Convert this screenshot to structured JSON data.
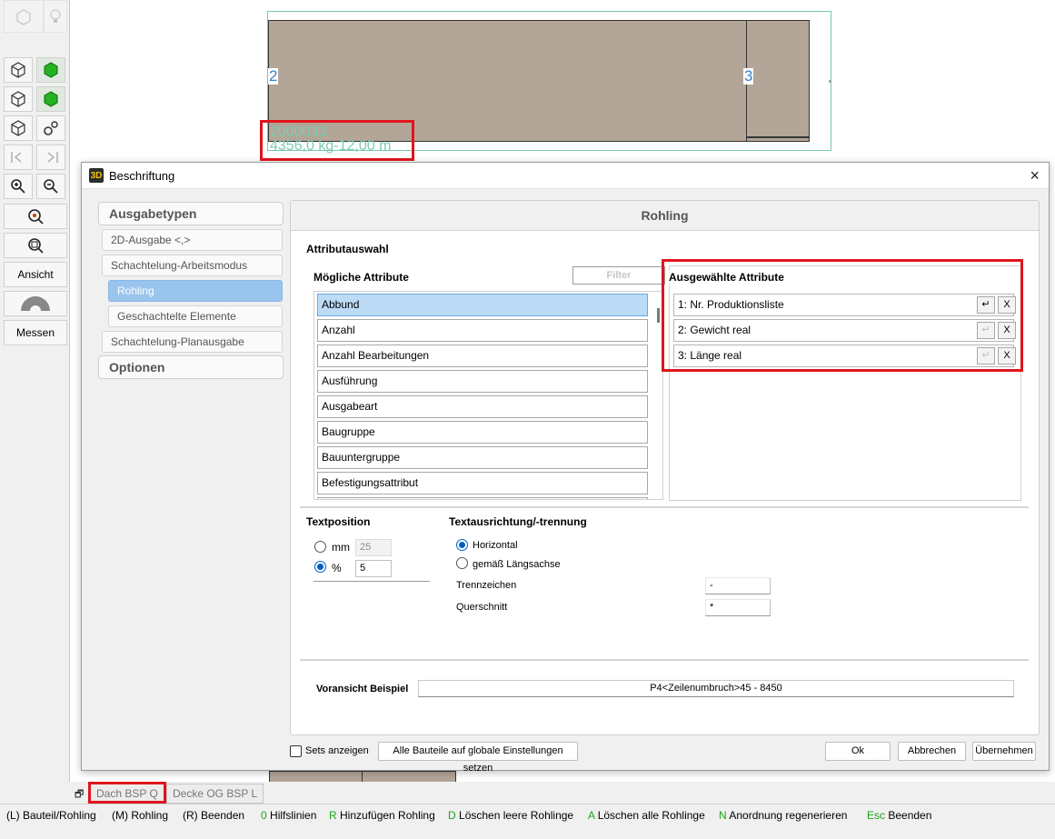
{
  "toolbar": {
    "ansicht": "Ansicht",
    "messen": "Messen"
  },
  "canvas": {
    "num_left": "2",
    "num_right": "3",
    "label_line1": "2000033",
    "label_line2": "4356,0 kg-12,00 m"
  },
  "dialog": {
    "title": "Beschriftung",
    "close": "×",
    "app_icon": "3D",
    "nav": {
      "ausgabetypen": "Ausgabetypen",
      "items": [
        "2D-Ausgabe <,>",
        "Schachtelung-Arbeitsmodus",
        "Rohling",
        "Geschachtelte Elemente",
        "Schachtelung-Planausgabe"
      ],
      "optionen": "Optionen"
    },
    "panel": {
      "title": "Rohling",
      "attributauswahl": "Attributauswahl",
      "moegliche": "Mögliche Attribute",
      "filter_placeholder": "Filter",
      "ausgewaehlte": "Ausgewählte Attribute",
      "possible_attributes": [
        "Abbund",
        "Anzahl",
        "Anzahl Bearbeitungen",
        "Ausführung",
        "Ausgabeart",
        "Baugruppe",
        "Bauuntergruppe",
        "Befestigungsattribut"
      ],
      "selected_attributes": [
        {
          "label": "1: Nr. Produktionsliste",
          "enter": "↵",
          "remove": "X"
        },
        {
          "label": "2: Gewicht real",
          "enter": "↵",
          "remove": "X"
        },
        {
          "label": "3: Länge real",
          "enter": "↵",
          "remove": "X"
        }
      ],
      "textposition": "Textposition",
      "mm_label": "mm",
      "mm_value": "25",
      "pct_label": "%",
      "pct_value": "5",
      "textausrichtung": "Textausrichtung/-trennung",
      "horizontal": "Horizontal",
      "laengsachse": "gemäß Längsachse",
      "trennzeichen_label": "Trennzeichen",
      "trennzeichen_value": "-",
      "querschnitt_label": "Querschnitt",
      "querschnitt_value": "*",
      "voransicht_label": "Voransicht Beispiel",
      "voransicht_value": "P4<Zeilenumbruch>45 - 8450"
    },
    "footer": {
      "sets_anzeigen": "Sets anzeigen",
      "global_button": "Alle Bauteile auf globale Einstellungen setzen",
      "ok": "Ok",
      "abbrechen": "Abbrechen",
      "uebernehmen": "Übernehmen"
    }
  },
  "tabs": [
    {
      "label": "Dach BSP Q"
    },
    {
      "label": "Decke OG BSP L"
    }
  ],
  "status": [
    {
      "key": "",
      "text": "(L) Bauteil/Rohling"
    },
    {
      "key": "",
      "text": "(M) Rohling"
    },
    {
      "key": "",
      "text": "(R) Beenden"
    },
    {
      "key": "0",
      "text": "Hilfslinien"
    },
    {
      "key": "R",
      "text": "Hinzufügen Rohling"
    },
    {
      "key": "D",
      "text": "Löschen leere Rohlinge"
    },
    {
      "key": "A",
      "text": "Löschen alle Rohlinge"
    },
    {
      "key": "N",
      "text": "Anordnung regenerieren"
    },
    {
      "key": "Esc",
      "text": "Beenden"
    }
  ]
}
